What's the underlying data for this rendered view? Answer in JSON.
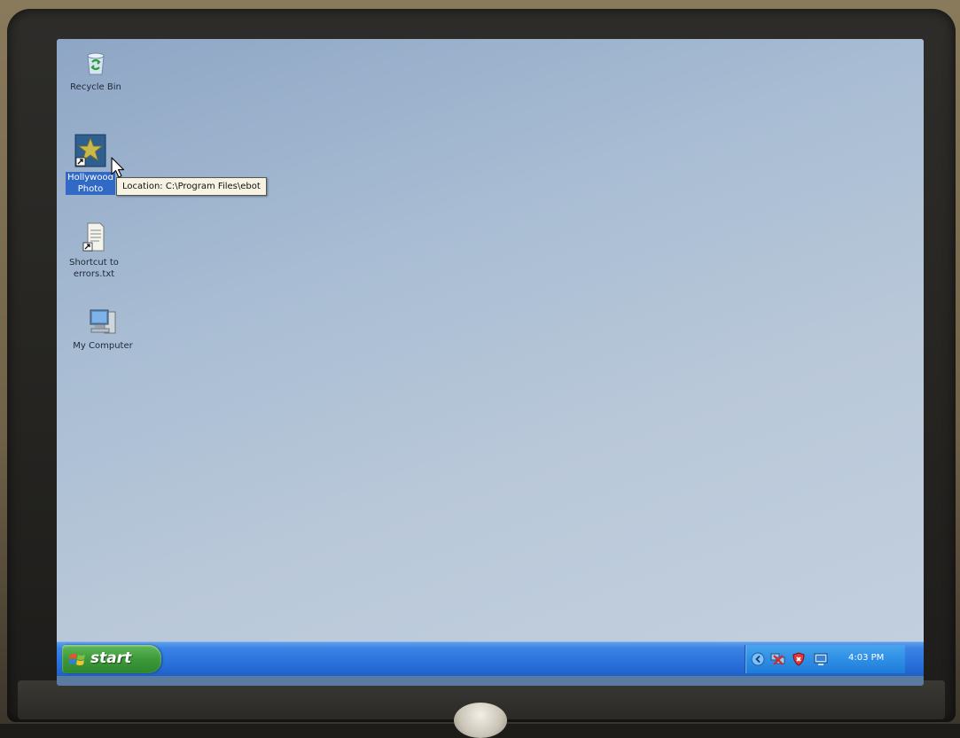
{
  "desktop": {
    "icons": [
      {
        "label": "Recycle Bin",
        "icon": "recycle-bin-icon"
      },
      {
        "label": "Hollywood Photo",
        "icon": "star-shortcut-icon",
        "selected": true
      },
      {
        "label_line1": "Shortcut to",
        "label_line2": "errors.txt",
        "icon": "text-file-shortcut-icon"
      },
      {
        "label": "My Computer",
        "icon": "my-computer-icon"
      }
    ],
    "tooltip": "Location: C:\\Program Files\\ebot"
  },
  "taskbar": {
    "start_label": "start",
    "clock": "4:03 PM",
    "tray_icons": [
      "show-hidden-icons-chevron",
      "network-disconnected-icon",
      "security-shield-icon",
      "monitor-icon"
    ]
  },
  "colors": {
    "desktop": "#a8bcd3",
    "taskbar": "#2a73dc",
    "start_button": "#3c9a3a",
    "selection": "#3169c6"
  }
}
